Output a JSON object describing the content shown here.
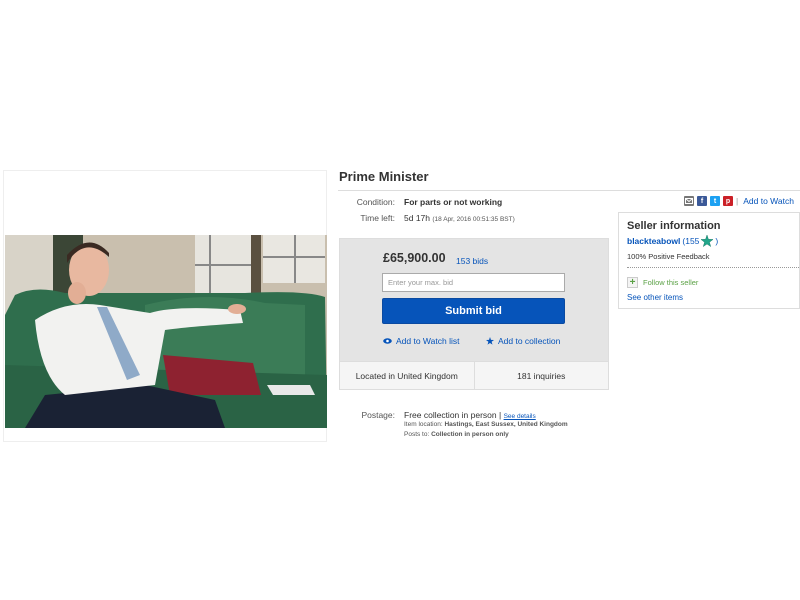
{
  "listing": {
    "title": "Prime Minister",
    "condition_label": "Condition:",
    "condition_value": "For parts or not working",
    "time_label": "Time left:",
    "time_value": "5d 17h",
    "time_detail": "(18 Apr, 2016   00:51:35 BST)",
    "share_watch": "Add to Watch"
  },
  "bid": {
    "price": "£65,900.00",
    "bids": "153 bids",
    "input_placeholder": "Enter your max. bid",
    "submit_label": "Submit bid",
    "watch_label": "Add to Watch list",
    "collection_label": "Add to collection",
    "location": "Located in United Kingdom",
    "inquiries": "181 inquiries"
  },
  "postage": {
    "label": "Postage:",
    "value": "Free collection in person",
    "sep": "|",
    "details_link": "See details",
    "item_location_label": "Item location:",
    "item_location_value": "Hastings, East Sussex, United Kingdom",
    "posts_to_label": "Posts to:",
    "posts_to_value": "Collection in person only"
  },
  "seller": {
    "title": "Seller information",
    "name": "blackteabowl",
    "score_open": "(155",
    "score_close": ")",
    "feedback": "100% Positive Feedback",
    "follow": "Follow this seller",
    "other_items": "See other items"
  },
  "colors": {
    "link_blue": "#0654ba",
    "submit_blue": "#0654ba",
    "follow_green": "#5ba145",
    "star_teal": "#21a68a"
  },
  "icons": [
    "email-icon",
    "facebook-icon",
    "twitter-icon",
    "pinterest-icon",
    "eye-icon",
    "star-icon",
    "plus-icon",
    "seller-star-icon"
  ]
}
